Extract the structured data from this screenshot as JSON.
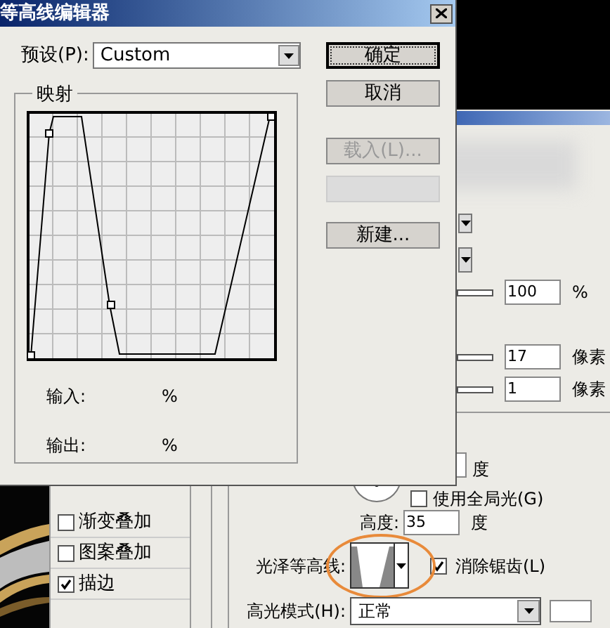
{
  "contour_editor": {
    "title": "等高线编辑器",
    "preset": {
      "label": "预设(P):",
      "value": "Custom"
    },
    "mapping": {
      "label": "映射",
      "input_label": "输入:",
      "input_unit": "%",
      "output_label": "输出:",
      "output_unit": "%"
    },
    "buttons": [
      {
        "label": "确定",
        "disabled": false,
        "default": true
      },
      {
        "label": "取消",
        "disabled": false,
        "default": false
      },
      {
        "label": "载入(L)...",
        "disabled": true,
        "default": false
      },
      {
        "label": "新建...",
        "disabled": false,
        "default": false
      }
    ]
  },
  "layer_style": {
    "effects": [
      {
        "label": "渐变叠加",
        "checked": false
      },
      {
        "label": "图案叠加",
        "checked": false
      },
      {
        "label": "描边",
        "checked": true
      }
    ],
    "fields": [
      {
        "value": "100",
        "unit": "%"
      },
      {
        "value": "17",
        "unit": "像素"
      },
      {
        "value": "1",
        "unit": "像素"
      }
    ],
    "angle_unit": "度",
    "global_light": {
      "label": "使用全局光(G)",
      "checked": false
    },
    "altitude": {
      "label": "高度:",
      "value": "35",
      "unit": "度"
    },
    "gloss_contour": {
      "label": "光泽等高线:"
    },
    "anti_alias": {
      "label": "消除锯齿(L)",
      "checked": true
    },
    "highlight_mode": {
      "label": "高光模式(H):",
      "value": "正常"
    }
  }
}
